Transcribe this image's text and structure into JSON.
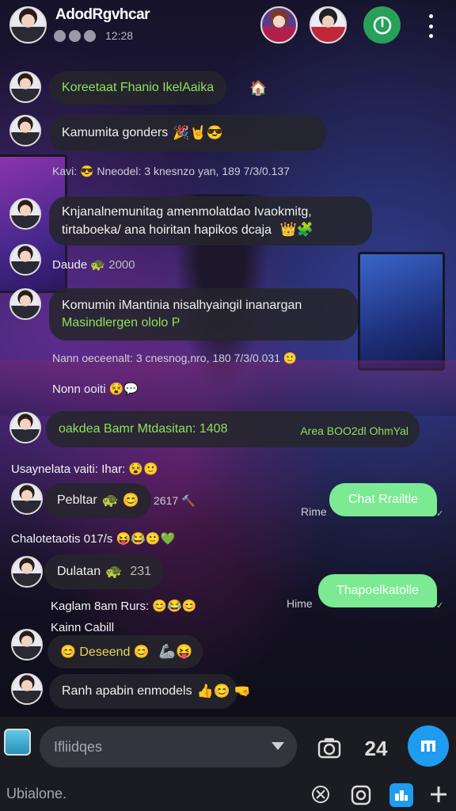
{
  "header": {
    "title": "AdodRgvhcar",
    "time": "12:28",
    "colors": {
      "status": "#27a15a",
      "accent": "#1f9cf0",
      "outgoing": "#7bea92",
      "highlight": "#8fe15a"
    }
  },
  "messages": {
    "m1": {
      "text": "Koreetaat Fhanio IkelAaika",
      "emoji": "🏠"
    },
    "m2": {
      "text": "Kamumita gonders",
      "emoji": "🎉🤘😎"
    },
    "meta1": {
      "text": "Kavi: 😎 Nneodel: 3 knesnzo yan, 189 7/3/0.137"
    },
    "m3": {
      "line1": "Knjanalnemunitag amenmolatdao Ivaokmitg,",
      "line2": "tirtaboeka/ ana hoiritan hapikos dcaja",
      "emoji": "👑🧩"
    },
    "meta2": {
      "label": "Daude",
      "emoji": "🐢",
      "value": "2000"
    },
    "m4": {
      "line1": "Komumin iMantinia nisalhyaingil inanargan",
      "line2": "Masindlergen ololo P"
    },
    "meta3": {
      "text": "Nann  oeceenalt: 3 cnesnog,nro, 180 7/3/0.031 🙂"
    },
    "meta4": {
      "text": "Nonn ooiti 😵💬"
    },
    "m5": {
      "green_text": "oakdea Bamr Mtdasitan: 1408",
      "right_text": "Area BOO2dl OhmYal"
    },
    "meta5": {
      "text": "Usaynelata vaiti: Ihar: 😵🙂"
    },
    "m6": {
      "name": "Pebltar",
      "emoji": "🐢 😊",
      "value": "2617 🔨"
    },
    "out1": {
      "text": "Chat Rrailtle",
      "time": "Rime"
    },
    "meta6": {
      "text": "Chalotetaotis 017/s 😝😂🙂💚"
    },
    "m7": {
      "name": "Dulatan",
      "emoji": "🐢",
      "value": "231"
    },
    "meta7": {
      "text": "Kaglam 8am Rurs: 😊😂😊"
    },
    "out2": {
      "text": "Thapoelkatolle",
      "time": "Hime"
    },
    "meta8": {
      "text": "Kainn Cabill"
    },
    "m8": {
      "text": "😊 Deseend 😊",
      "extra": "🦾😝"
    },
    "m9": {
      "text": "Ranh apabin enmodels",
      "emoji": "👍😊 🤜"
    }
  },
  "composer": {
    "placeholder": "Ifliidqes",
    "counter": "24",
    "bottom_text": "Ubialone."
  }
}
